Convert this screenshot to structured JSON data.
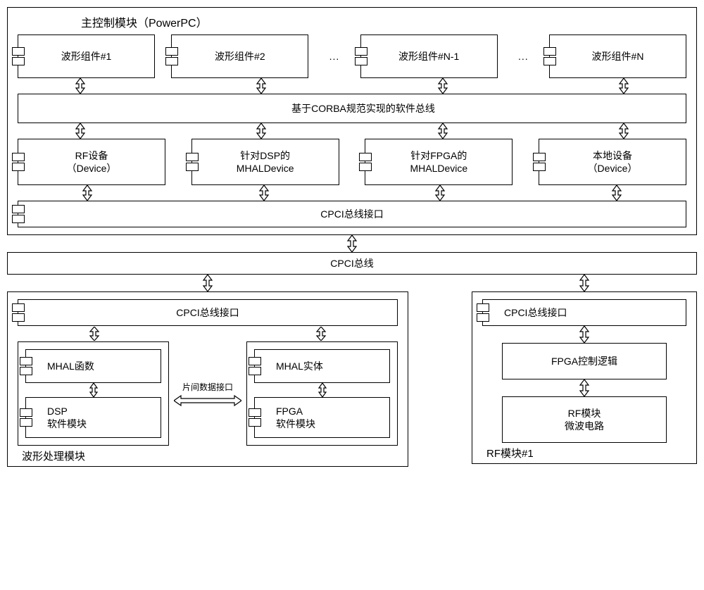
{
  "main_module": {
    "title": "主控制模块（PowerPC）",
    "components_row1": {
      "items": [
        {
          "label": "波形组件#1"
        },
        {
          "label": "波形组件#2"
        },
        {
          "label": "波形组件#N-1"
        },
        {
          "label": "波形组件#N"
        }
      ],
      "ellipsis": "..."
    },
    "software_bus": "基于CORBA规范实现的软件总线",
    "components_row2": {
      "items": [
        {
          "label": "RF设备\n（Device）"
        },
        {
          "label": "针对DSP的\nMHALDevice"
        },
        {
          "label": "针对FPGA的\nMHALDevice"
        },
        {
          "label": "本地设备\n（Device）"
        }
      ]
    },
    "cpci_interface": "CPCI总线接口"
  },
  "cpci_bus": "CPCI总线",
  "waveform_module": {
    "title": "波形处理模块",
    "cpci_interface": "CPCI总线接口",
    "inter_chip": "片间数据接口",
    "dsp_group": {
      "mhal": "MHAL函数",
      "sw": "DSP\n软件模块"
    },
    "fpga_group": {
      "mhal": "MHAL实体",
      "sw": "FPGA\n软件模块"
    }
  },
  "rf_module": {
    "title": "RF模块#1",
    "cpci_interface": "CPCI总线接口",
    "control": "FPGA控制逻辑",
    "rf": "RF模块\n微波电路"
  }
}
